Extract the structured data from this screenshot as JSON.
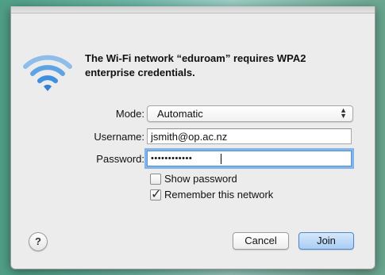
{
  "dialog": {
    "message": "The Wi-Fi network “eduroam” requires WPA2 enterprise credentials.",
    "icon": "wifi-icon"
  },
  "form": {
    "mode_label": "Mode:",
    "mode_value": "Automatic",
    "username_label": "Username:",
    "username_value": "jsmith@op.ac.nz",
    "password_label": "Password:",
    "password_value": "••••••••••••"
  },
  "options": {
    "show_password_label": "Show password",
    "show_password_checked": false,
    "remember_label": "Remember this network",
    "remember_checked": true
  },
  "buttons": {
    "help": "?",
    "cancel": "Cancel",
    "join": "Join"
  },
  "colors": {
    "wifi_blue": "#3f8ee0",
    "focus_ring": "#80b5ea",
    "primary_button": "#a9cdf3"
  }
}
